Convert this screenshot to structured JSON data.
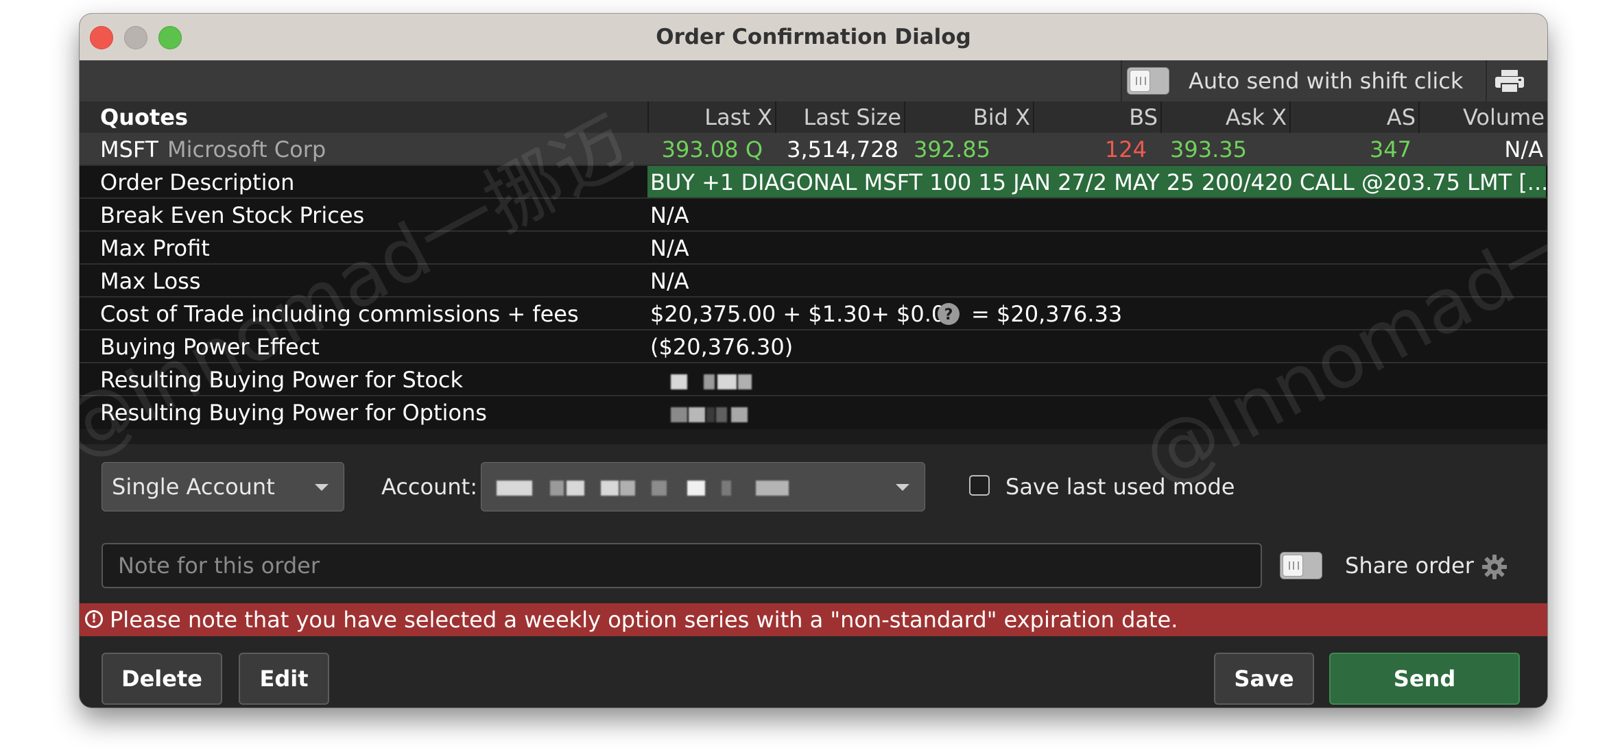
{
  "window": {
    "title": "Order Confirmation Dialog"
  },
  "toolbar": {
    "auto_send_label": "Auto send with shift click"
  },
  "quotes": {
    "header": {
      "title": "Quotes",
      "columns": [
        "Last X",
        "Last Size",
        "Bid X",
        "BS",
        "Ask X",
        "AS",
        "Volume"
      ]
    },
    "row": {
      "symbol": "MSFT",
      "name": "Microsoft Corp",
      "last_x": "393.08 Q",
      "last_size": "3,514,728",
      "bid_x": "392.85",
      "bs": "124",
      "ask_x": "393.35",
      "as": "347",
      "volume": "N/A"
    }
  },
  "details": {
    "order_description": {
      "label": "Order Description",
      "value": "BUY +1 DIAGONAL MSFT 100 15 JAN 27/2 MAY 25 200/420 CALL @203.75 LMT [..."
    },
    "break_even": {
      "label": "Break Even Stock Prices",
      "value": "N/A"
    },
    "max_profit": {
      "label": "Max Profit",
      "value": "N/A"
    },
    "max_loss": {
      "label": "Max Loss",
      "value": "N/A"
    },
    "cost_of_trade": {
      "label": "Cost of Trade including commissions + fees",
      "value": "$20,375.00 + $1.30+ $0.03",
      "total": "= $20,376.33"
    },
    "buying_power_effect": {
      "label": "Buying Power Effect",
      "value": "($20,376.30)"
    },
    "resulting_bp_stock": {
      "label": "Resulting Buying Power for Stock"
    },
    "resulting_bp_options": {
      "label": "Resulting Buying Power for Options"
    }
  },
  "account": {
    "mode_selected": "Single Account",
    "account_label": "Account:",
    "save_mode_label": "Save last used mode"
  },
  "note": {
    "placeholder": "Note for this order",
    "share_label": "Share order"
  },
  "warning": {
    "text": "Please note that you have selected a weekly option series with a \"non-standard\" expiration date."
  },
  "buttons": {
    "delete": "Delete",
    "edit": "Edit",
    "save": "Save",
    "send": "Send"
  },
  "watermark": {
    "text_1": "@Innomad一挪迈",
    "text_2": "@Innomad一挪迈"
  },
  "colors": {
    "accent_green": "#2e6b3e",
    "warning_red": "#9e3232",
    "quote_green": "#6fd35a",
    "quote_red": "#ee5a50"
  }
}
